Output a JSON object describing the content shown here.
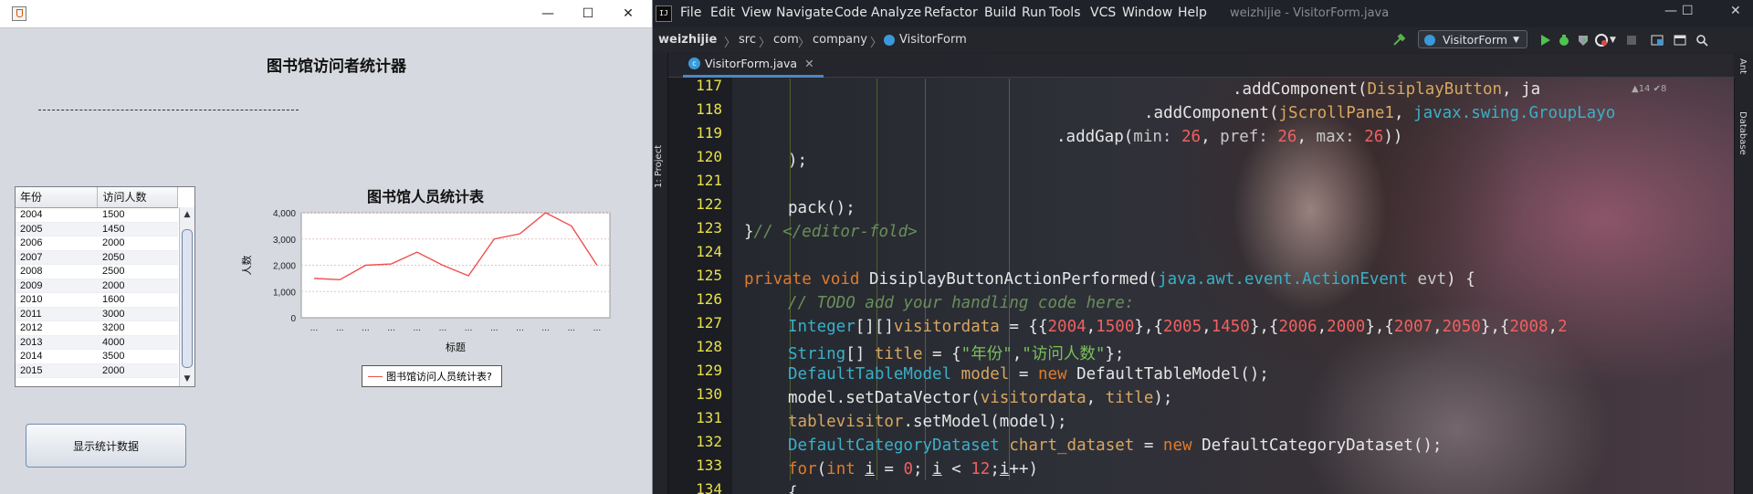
{
  "swing": {
    "main_title": "图书馆访问者统计器",
    "table": {
      "headers": [
        "年份",
        "访问人数"
      ],
      "rows": [
        [
          "2004",
          "1500"
        ],
        [
          "2005",
          "1450"
        ],
        [
          "2006",
          "2000"
        ],
        [
          "2007",
          "2050"
        ],
        [
          "2008",
          "2500"
        ],
        [
          "2009",
          "2000"
        ],
        [
          "2010",
          "1600"
        ],
        [
          "2011",
          "3000"
        ],
        [
          "2012",
          "3200"
        ],
        [
          "2013",
          "4000"
        ],
        [
          "2014",
          "3500"
        ],
        [
          "2015",
          "2000"
        ]
      ]
    },
    "button_label": "显示统计数据",
    "window_buttons": {
      "minimize": "—",
      "maximize": "☐",
      "close": "✕"
    }
  },
  "chart_data": {
    "type": "line",
    "title": "图书馆人员统计表",
    "xlabel": "标题",
    "ylabel": "人数",
    "ylim": [
      0,
      4000
    ],
    "yticks": [
      "0",
      "1,000",
      "2,000",
      "3,000",
      "4,000"
    ],
    "categories": [
      "...",
      "...",
      "...",
      "...",
      "...",
      "...",
      "...",
      "...",
      "...",
      "...",
      "...",
      "..."
    ],
    "series": [
      {
        "name": "图书馆访问人员统计表?",
        "color": "#f0504f",
        "values": [
          1500,
          1450,
          2000,
          2050,
          2500,
          2000,
          1600,
          3000,
          3200,
          4000,
          3500,
          2000
        ]
      }
    ],
    "grid": true,
    "legend": "bottom"
  },
  "ide": {
    "window_title": "weizhijie - VisitorForm.java",
    "menu": [
      "File",
      "Edit",
      "View",
      "Navigate",
      "Code",
      "Analyze",
      "Refactor",
      "Build",
      "Run",
      "Tools",
      "VCS",
      "Window",
      "Help"
    ],
    "breadcrumbs": [
      "weizhijie",
      "src",
      "com",
      "company",
      "VisitorForm"
    ],
    "run_config": "VisitorForm",
    "tab": "VisitorForm.java",
    "left_tool": "1: Project",
    "right_tools": [
      "Ant",
      "Database"
    ],
    "inspection": "▲14 ✔8",
    "line_numbers": [
      "117",
      "118",
      "119",
      "120",
      "121",
      "122",
      "123",
      "124",
      "125",
      "126",
      "127",
      "128",
      "129",
      "130",
      "131",
      "132",
      "133",
      "134"
    ]
  }
}
